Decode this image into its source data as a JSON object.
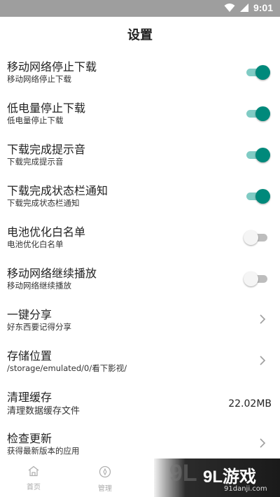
{
  "status_bar": {
    "time": "9:01",
    "icons": [
      "wifi-icon",
      "cell-signal-icon"
    ]
  },
  "header": {
    "title": "设置"
  },
  "settings": [
    {
      "title": "移动网络停止下载",
      "subtitle": "移动网络停止下载",
      "control": "toggle",
      "state": true
    },
    {
      "title": "低电量停止下载",
      "subtitle": "低电量停止下载",
      "control": "toggle",
      "state": true
    },
    {
      "title": "下载完成提示音",
      "subtitle": "下载完成提示音",
      "control": "toggle",
      "state": true
    },
    {
      "title": "下载完成状态栏通知",
      "subtitle": "下载完成状态栏通知",
      "control": "toggle",
      "state": true
    },
    {
      "title": "电池优化白名单",
      "subtitle": "电池优化白名单",
      "control": "toggle",
      "state": false
    },
    {
      "title": "移动网络继续播放",
      "subtitle": "移动网络继续播放",
      "control": "toggle",
      "state": false
    },
    {
      "title": "一键分享",
      "subtitle": "好东西要记得分享",
      "control": "chevron"
    },
    {
      "title": "存储位置",
      "subtitle": "/storage/emulated/0/看下影视/",
      "control": "chevron"
    },
    {
      "title": "清理缓存",
      "subtitle": "清理数据缓存文件",
      "control": "value",
      "value": "22.02MB"
    },
    {
      "title": "检查更新",
      "subtitle": "获得最新版本的应用",
      "control": "chevron"
    }
  ],
  "bottom_nav": [
    {
      "label": "首页",
      "icon": "home-icon"
    },
    {
      "label": "管理",
      "icon": "compass-icon"
    }
  ],
  "watermark": {
    "logo": "9L游戏",
    "url": "91danji.com"
  },
  "colors": {
    "accent": "#00897b",
    "accent_track": "#80cbc4",
    "status_bar": "#9e9e9e"
  }
}
